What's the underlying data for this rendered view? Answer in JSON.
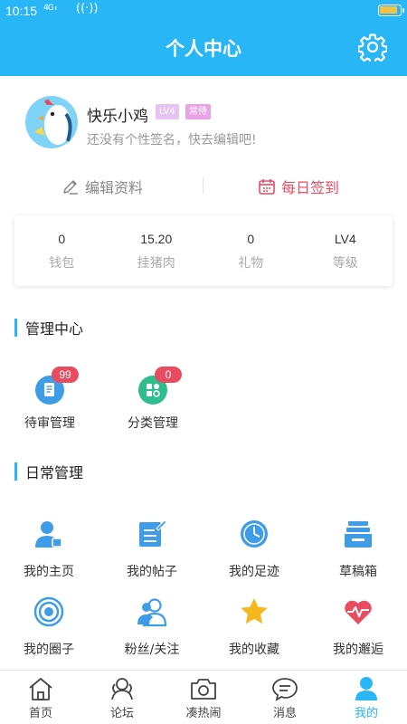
{
  "status_bar": {
    "time": "10:15",
    "signal": "4G ᵢₗ",
    "wifi": "((·))",
    "battery_level": 0.9
  },
  "header": {
    "title": "个人中心"
  },
  "profile": {
    "username": "快乐小鸡",
    "level_badge": "LV4",
    "role_badge": "常侍",
    "signature": "还没有个性签名，快去编辑吧!"
  },
  "actions": {
    "edit_label": "编辑资料",
    "checkin_label": "每日签到"
  },
  "stats": [
    {
      "value": "0",
      "label": "钱包"
    },
    {
      "value": "15.20",
      "label": "挂猪肉"
    },
    {
      "value": "0",
      "label": "礼物"
    },
    {
      "value": "LV4",
      "label": "等级"
    }
  ],
  "management": {
    "title": "管理中心",
    "items": [
      {
        "label": "待审管理",
        "count": "99"
      },
      {
        "label": "分类管理",
        "count": "0"
      }
    ]
  },
  "daily": {
    "title": "日常管理",
    "items": [
      {
        "label": "我的主页"
      },
      {
        "label": "我的帖子"
      },
      {
        "label": "我的足迹"
      },
      {
        "label": "草稿箱"
      },
      {
        "label": "我的圈子"
      },
      {
        "label": "粉丝/关注"
      },
      {
        "label": "我的收藏"
      },
      {
        "label": "我的邂逅"
      }
    ]
  },
  "nav": [
    {
      "label": "首页",
      "icon": "home-icon"
    },
    {
      "label": "论坛",
      "icon": "forum-icon"
    },
    {
      "label": "凑热闹",
      "icon": "camera-icon"
    },
    {
      "label": "消息",
      "icon": "message-icon"
    },
    {
      "label": "我的",
      "icon": "user-icon"
    }
  ],
  "colors": {
    "primary": "#29b6f6",
    "accent_red": "#e84c61",
    "badge_purple": "#e8a4e7"
  }
}
